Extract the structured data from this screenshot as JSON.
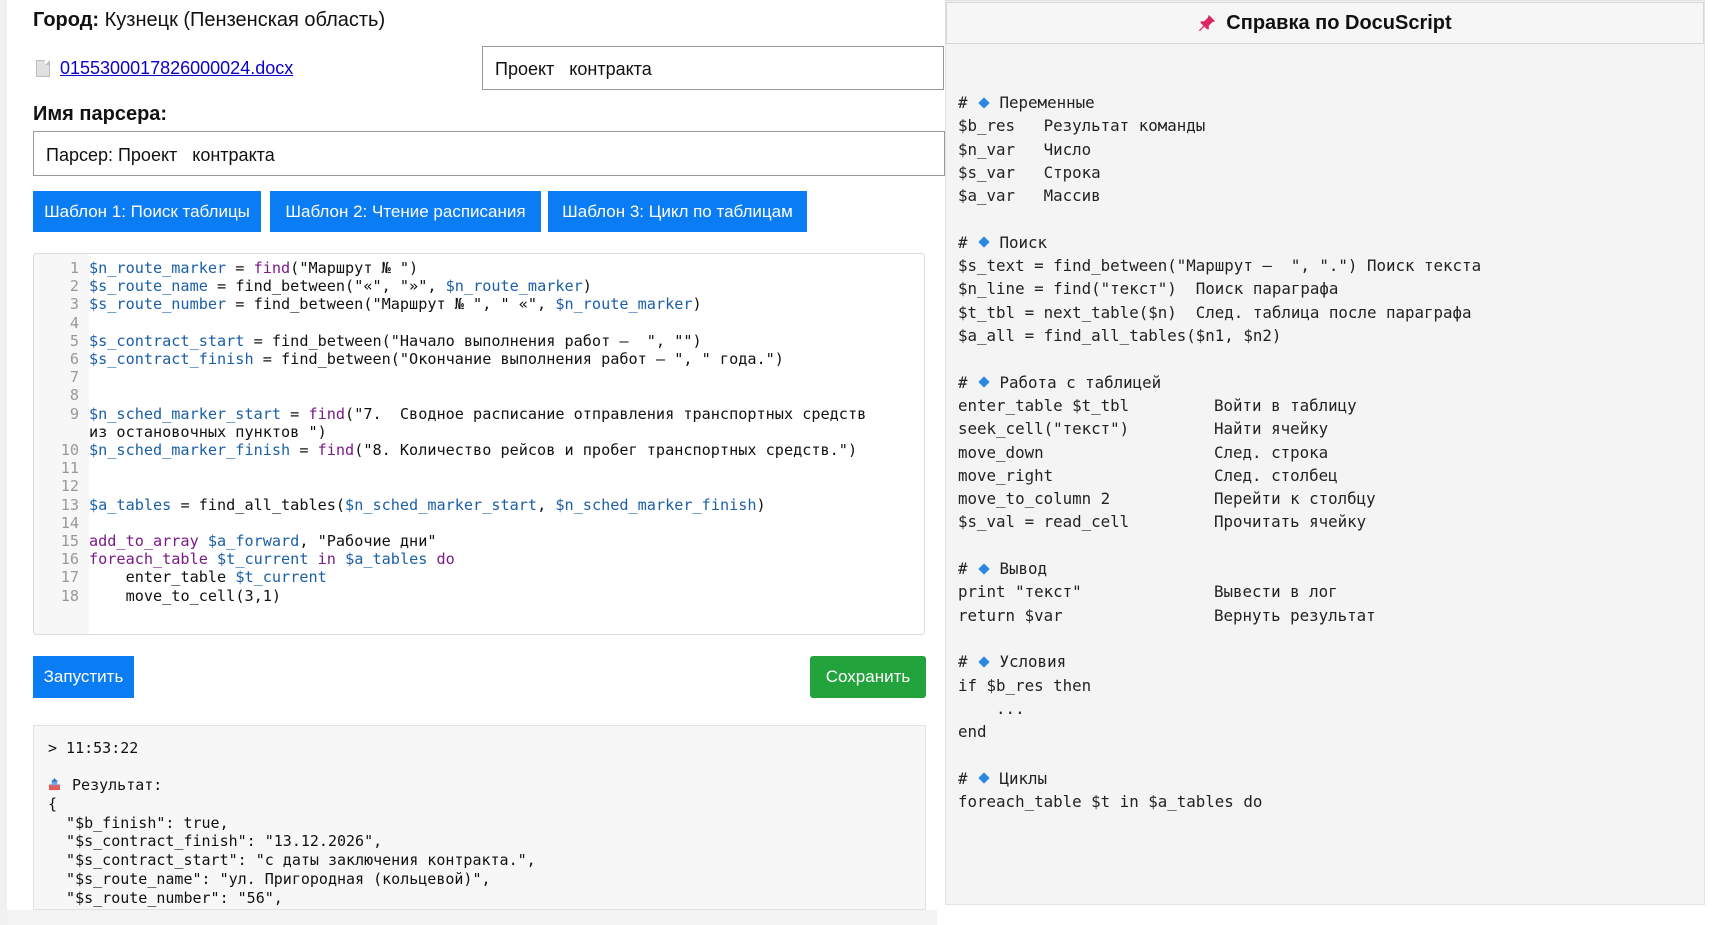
{
  "header": {
    "city_label": "Город:",
    "city_value": " Кузнецк (Пензенская область)",
    "file_name": "0155300017826000024.docx",
    "doc_type": "Проект   контракта",
    "parser_label": "Имя парсера:",
    "parser_value": "Парсер: Проект   контракта"
  },
  "templates": [
    "Шаблон 1: Поиск таблицы",
    "Шаблон 2: Чтение расписания",
    "Шаблон 3: Цикл по таблицам"
  ],
  "editor": {
    "lines": [
      {
        "n": "1",
        "text": "$n_route_marker = find(\"Маршрут № \")"
      },
      {
        "n": "2",
        "text": "$s_route_name = find_between(\"«\", \"»\", $n_route_marker)"
      },
      {
        "n": "3",
        "text": "$s_route_number = find_between(\"Маршрут № \", \" «\", $n_route_marker)"
      },
      {
        "n": "4",
        "text": ""
      },
      {
        "n": "5",
        "text": "$s_contract_start = find_between(\"Начало выполнения работ –  \", \"\")"
      },
      {
        "n": "6",
        "text": "$s_contract_finish = find_between(\"Окончание выполнения работ – \", \" года.\")"
      },
      {
        "n": "7",
        "text": ""
      },
      {
        "n": "8",
        "text": ""
      },
      {
        "n": "9",
        "text": "$n_sched_marker_start = find(\"7.  Сводное расписание отправления транспортных средств"
      },
      {
        "n": "",
        "text": "из остановочных пунктов \")"
      },
      {
        "n": "10",
        "text": "$n_sched_marker_finish = find(\"8. Количество рейсов и пробег транспортных средств.\")"
      },
      {
        "n": "11",
        "text": ""
      },
      {
        "n": "12",
        "text": ""
      },
      {
        "n": "13",
        "text": "$a_tables = find_all_tables($n_sched_marker_start, $n_sched_marker_finish)"
      },
      {
        "n": "14",
        "text": ""
      },
      {
        "n": "15",
        "text": "add_to_array $a_forward, \"Рабочие дни\""
      },
      {
        "n": "16",
        "text": "foreach_table $t_current in $a_tables do"
      },
      {
        "n": "17",
        "text": "    enter_table $t_current"
      },
      {
        "n": "18",
        "text": "    move_to_cell(3,1)"
      }
    ]
  },
  "actions": {
    "run_label": "Запустить",
    "save_label": "Сохранить"
  },
  "output": {
    "lines": [
      "> 11:53:22",
      "",
      "Результат:",
      "{",
      "  \"$b_finish\": true,",
      "  \"$s_contract_finish\": \"13.12.2026\",",
      "  \"$s_contract_start\": \"с даты заключения контракта.\",",
      "  \"$s_route_name\": \"ул. Пригородная (кольцевой)\",",
      "  \"$s_route_number\": \"56\","
    ]
  },
  "help": {
    "title": "Справка по DocuScript",
    "lines": [
      {
        "heading": "Переменные"
      },
      {
        "a": "$b_res   Результат команды",
        "b": ""
      },
      {
        "a": "$n_var   Число",
        "b": ""
      },
      {
        "a": "$s_var   Строка",
        "b": ""
      },
      {
        "a": "$a_var   Массив",
        "b": ""
      },
      {
        "blank": true
      },
      {
        "heading": "Поиск"
      },
      {
        "a": "$s_text = find_between(\"Маршрут –  \", \".\") Поиск текста",
        "b": ""
      },
      {
        "a": "$n_line = find(\"текст\")  Поиск параграфа",
        "b": ""
      },
      {
        "a": "$t_tbl = next_table($n)  След. таблица после параграфа",
        "b": ""
      },
      {
        "a": "$a_all = find_all_tables($n1, $n2)",
        "b": ""
      },
      {
        "blank": true
      },
      {
        "heading": "Работа с таблицей"
      },
      {
        "a": "enter_table $t_tbl",
        "b": "Войти в таблицу"
      },
      {
        "a": "seek_cell(\"текст\")",
        "b": "Найти ячейку"
      },
      {
        "a": "move_down",
        "b": "След. строка"
      },
      {
        "a": "move_right",
        "b": "След. столбец"
      },
      {
        "a": "move_to_column 2",
        "b": "Перейти к столбцу"
      },
      {
        "a": "$s_val = read_cell",
        "b": "Прочитать ячейку"
      },
      {
        "blank": true
      },
      {
        "heading": "Вывод"
      },
      {
        "a": "print \"текст\"",
        "b": "Вывести в лог"
      },
      {
        "a": "return $var",
        "b": "Вернуть результат"
      },
      {
        "blank": true
      },
      {
        "heading": "Условия"
      },
      {
        "a": "if $b_res then",
        "b": ""
      },
      {
        "a": "    ...",
        "b": ""
      },
      {
        "a": "end",
        "b": ""
      },
      {
        "blank": true
      },
      {
        "heading": "Циклы"
      },
      {
        "a": "foreach_table $t in $a_tables do",
        "b": ""
      }
    ]
  },
  "colors": {
    "primary": "#0a7cf4",
    "success": "#22a33b",
    "link": "#0b00c9",
    "variable": "#1b5fa8",
    "function": "#7a1a86"
  },
  "icons": [
    "file-icon",
    "pin-icon",
    "result-icon",
    "diamond-icon"
  ]
}
